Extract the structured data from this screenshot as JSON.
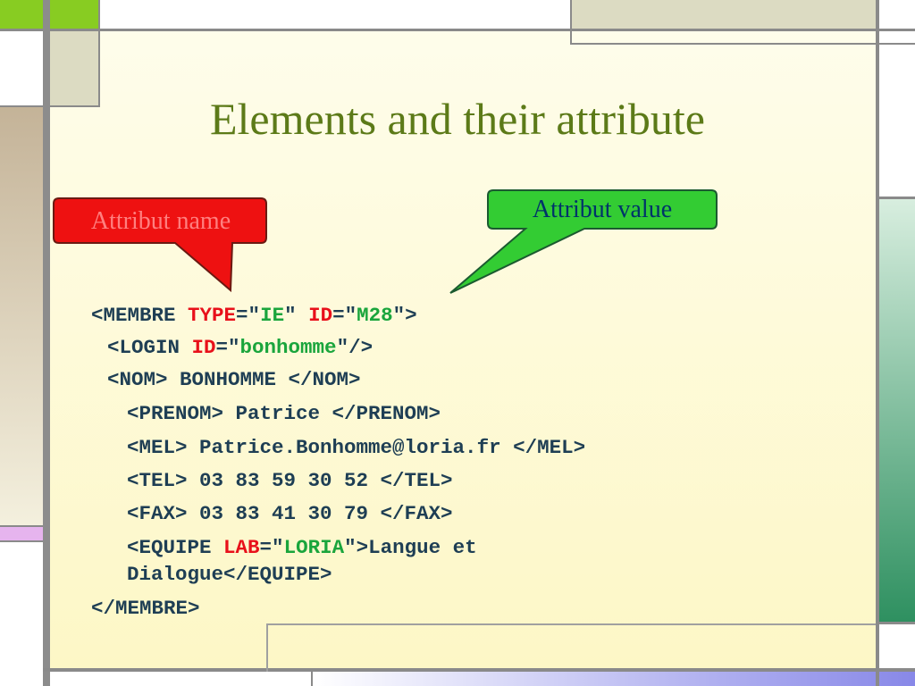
{
  "slide": {
    "title": "Elements and their attribute",
    "callouts": {
      "name_label": "Attribut name",
      "value_label": "Attribut value"
    },
    "code": {
      "l1": {
        "a": "<MEMBRE ",
        "b": "TYPE",
        "c": "=\"",
        "d": "IE",
        "e": "\" ",
        "f": "ID",
        "g": "=\"",
        "h": "M28",
        "i": "\">"
      },
      "l2": {
        "a": "<LOGIN ",
        "b": "ID",
        "c": "=\"",
        "d": "bonhomme",
        "e": "\"/>"
      },
      "l3": "<NOM> BONHOMME </NOM>",
      "l4": "<PRENOM> Patrice </PRENOM>",
      "l5": "<MEL> Patrice.Bonhomme@loria.fr </MEL>",
      "l6": "<TEL> 03 83 59 30 52 </TEL>",
      "l7": "<FAX> 03 83 41 30 79 </FAX>",
      "l8": {
        "a": "<EQUIPE ",
        "b": "LAB",
        "c": "=\"",
        "d": "LORIA",
        "e": "\">Langue et"
      },
      "l9": "Dialogue</EQUIPE>",
      "l10": "</MEMBRE>"
    },
    "colors": {
      "title": "#5c7a18",
      "code_text": "#1e3e54",
      "attribute_name": "#e8101a",
      "attribute_value": "#1aa53c",
      "callout_name_fill": "#ee1111",
      "callout_value_fill": "#33cc33"
    }
  }
}
